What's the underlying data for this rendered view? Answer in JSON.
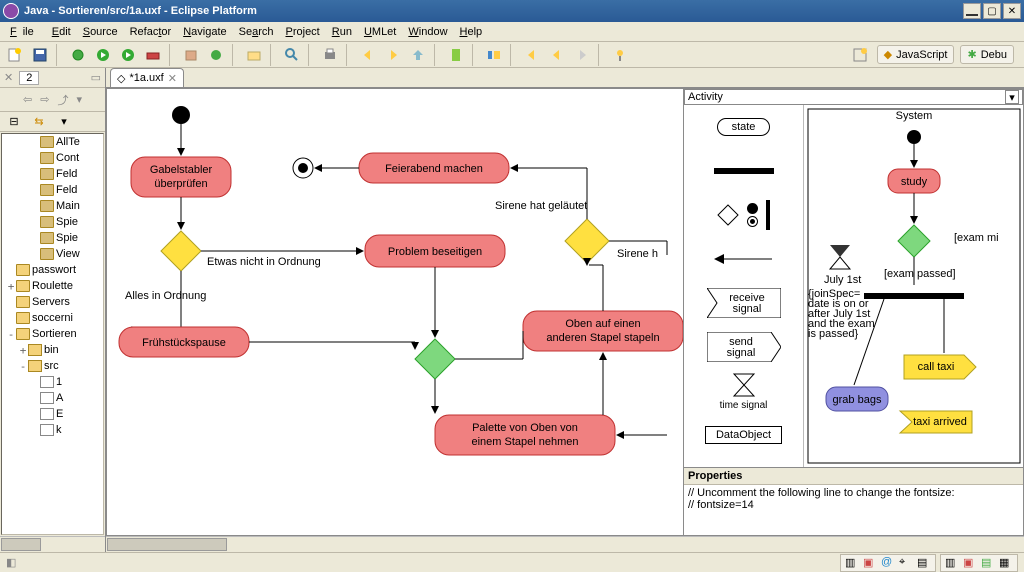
{
  "titlebar": {
    "title": "Java - Sortieren/src/1a.uxf - Eclipse Platform"
  },
  "menu": {
    "file": "File",
    "edit": "Edit",
    "source": "Source",
    "refactor": "Refactor",
    "navigate": "Navigate",
    "search": "Search",
    "project": "Project",
    "run": "Run",
    "umlet": "UMLet",
    "window": "Window",
    "help": "Help"
  },
  "perspectives": {
    "javascript": "JavaScript",
    "debug": "Debu"
  },
  "leftpane": {
    "tab": "2"
  },
  "tree": {
    "items": [
      {
        "indent": 2,
        "twist": "",
        "icon": "pkg",
        "label": "AllTe"
      },
      {
        "indent": 2,
        "twist": "",
        "icon": "pkg",
        "label": "Cont"
      },
      {
        "indent": 2,
        "twist": "",
        "icon": "pkg",
        "label": "Feld"
      },
      {
        "indent": 2,
        "twist": "",
        "icon": "pkg",
        "label": "Feld"
      },
      {
        "indent": 2,
        "twist": "",
        "icon": "pkg",
        "label": "Main"
      },
      {
        "indent": 2,
        "twist": "",
        "icon": "pkg",
        "label": "Spie"
      },
      {
        "indent": 2,
        "twist": "",
        "icon": "pkg",
        "label": "Spie"
      },
      {
        "indent": 2,
        "twist": "",
        "icon": "pkg",
        "label": "View"
      },
      {
        "indent": 0,
        "twist": "",
        "icon": "folder",
        "label": "passwort"
      },
      {
        "indent": 0,
        "twist": "+",
        "icon": "folder",
        "label": "Roulette"
      },
      {
        "indent": 0,
        "twist": "",
        "icon": "folder",
        "label": "Servers"
      },
      {
        "indent": 0,
        "twist": "",
        "icon": "folder",
        "label": "soccerni"
      },
      {
        "indent": 0,
        "twist": "-",
        "icon": "folder",
        "label": "Sortieren"
      },
      {
        "indent": 1,
        "twist": "+",
        "icon": "srcfolder",
        "label": "bin"
      },
      {
        "indent": 1,
        "twist": "-",
        "icon": "srcfolder",
        "label": "src"
      },
      {
        "indent": 2,
        "twist": "",
        "icon": "file",
        "label": "1"
      },
      {
        "indent": 2,
        "twist": "",
        "icon": "file",
        "label": "A"
      },
      {
        "indent": 2,
        "twist": "",
        "icon": "file",
        "label": "E"
      },
      {
        "indent": 2,
        "twist": "",
        "icon": "file",
        "label": "k"
      }
    ]
  },
  "editor": {
    "tabTitle": "*1a.uxf"
  },
  "diagram": {
    "a1": "Gabelstabler\nüberprüfen",
    "a2": "Feierabend machen",
    "a3": "Problem beseitigen",
    "a4": "Frühstückspause",
    "a5": "Oben auf einen\nanderen Stapel stapeln",
    "a6": "Palette von Oben von\neinem Stapel nehmen",
    "e1": "Etwas nicht in Ordnung",
    "e2": "Alles in Ordnung",
    "e3": "Sirene hat geläutet",
    "e4": "Sirene h"
  },
  "palette": {
    "head": "Activity",
    "state": "state",
    "receive": "receive\nsignal",
    "send": "send\nsignal",
    "time": "time signal",
    "dataobject": "DataObject",
    "sample": {
      "system": "System",
      "study": "study",
      "exammi": "[exam mi",
      "exampassed": "[exam passed]",
      "july": "July 1st",
      "joinspec": "{joinSpec=\ndate is on or\nafter July 1st\nand the exam\nis passed}",
      "grab": "grab bags",
      "calltaxi": "call taxi",
      "taxiarrived": "taxi arrived"
    }
  },
  "properties": {
    "head": "Properties",
    "line1": "// Uncomment the following line to change the fontsize:",
    "line2": "// fontsize=14"
  }
}
